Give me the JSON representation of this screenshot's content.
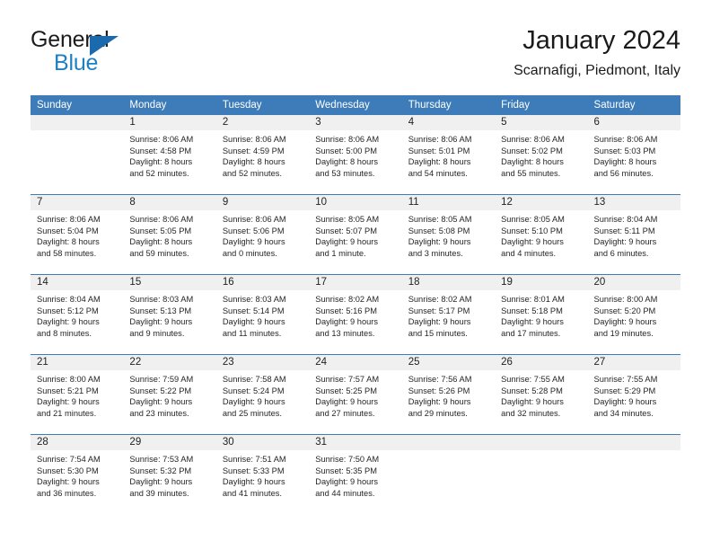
{
  "brand": {
    "name_top": "General",
    "name_bottom": "Blue",
    "accent_color": "#1f7fc4",
    "triangle_color": "#1a6aad"
  },
  "header": {
    "title": "January 2024",
    "subtitle": "Scarnafigi, Piedmont, Italy",
    "header_bg": "#3d7cb8",
    "daynum_bg": "#f0f0f0"
  },
  "weekday_headers": [
    "Sunday",
    "Monday",
    "Tuesday",
    "Wednesday",
    "Thursday",
    "Friday",
    "Saturday"
  ],
  "weeks": [
    [
      {
        "day": "",
        "sunrise": "",
        "sunset": "",
        "daylight1": "",
        "daylight2": ""
      },
      {
        "day": "1",
        "sunrise": "Sunrise: 8:06 AM",
        "sunset": "Sunset: 4:58 PM",
        "daylight1": "Daylight: 8 hours",
        "daylight2": "and 52 minutes."
      },
      {
        "day": "2",
        "sunrise": "Sunrise: 8:06 AM",
        "sunset": "Sunset: 4:59 PM",
        "daylight1": "Daylight: 8 hours",
        "daylight2": "and 52 minutes."
      },
      {
        "day": "3",
        "sunrise": "Sunrise: 8:06 AM",
        "sunset": "Sunset: 5:00 PM",
        "daylight1": "Daylight: 8 hours",
        "daylight2": "and 53 minutes."
      },
      {
        "day": "4",
        "sunrise": "Sunrise: 8:06 AM",
        "sunset": "Sunset: 5:01 PM",
        "daylight1": "Daylight: 8 hours",
        "daylight2": "and 54 minutes."
      },
      {
        "day": "5",
        "sunrise": "Sunrise: 8:06 AM",
        "sunset": "Sunset: 5:02 PM",
        "daylight1": "Daylight: 8 hours",
        "daylight2": "and 55 minutes."
      },
      {
        "day": "6",
        "sunrise": "Sunrise: 8:06 AM",
        "sunset": "Sunset: 5:03 PM",
        "daylight1": "Daylight: 8 hours",
        "daylight2": "and 56 minutes."
      }
    ],
    [
      {
        "day": "7",
        "sunrise": "Sunrise: 8:06 AM",
        "sunset": "Sunset: 5:04 PM",
        "daylight1": "Daylight: 8 hours",
        "daylight2": "and 58 minutes."
      },
      {
        "day": "8",
        "sunrise": "Sunrise: 8:06 AM",
        "sunset": "Sunset: 5:05 PM",
        "daylight1": "Daylight: 8 hours",
        "daylight2": "and 59 minutes."
      },
      {
        "day": "9",
        "sunrise": "Sunrise: 8:06 AM",
        "sunset": "Sunset: 5:06 PM",
        "daylight1": "Daylight: 9 hours",
        "daylight2": "and 0 minutes."
      },
      {
        "day": "10",
        "sunrise": "Sunrise: 8:05 AM",
        "sunset": "Sunset: 5:07 PM",
        "daylight1": "Daylight: 9 hours",
        "daylight2": "and 1 minute."
      },
      {
        "day": "11",
        "sunrise": "Sunrise: 8:05 AM",
        "sunset": "Sunset: 5:08 PM",
        "daylight1": "Daylight: 9 hours",
        "daylight2": "and 3 minutes."
      },
      {
        "day": "12",
        "sunrise": "Sunrise: 8:05 AM",
        "sunset": "Sunset: 5:10 PM",
        "daylight1": "Daylight: 9 hours",
        "daylight2": "and 4 minutes."
      },
      {
        "day": "13",
        "sunrise": "Sunrise: 8:04 AM",
        "sunset": "Sunset: 5:11 PM",
        "daylight1": "Daylight: 9 hours",
        "daylight2": "and 6 minutes."
      }
    ],
    [
      {
        "day": "14",
        "sunrise": "Sunrise: 8:04 AM",
        "sunset": "Sunset: 5:12 PM",
        "daylight1": "Daylight: 9 hours",
        "daylight2": "and 8 minutes."
      },
      {
        "day": "15",
        "sunrise": "Sunrise: 8:03 AM",
        "sunset": "Sunset: 5:13 PM",
        "daylight1": "Daylight: 9 hours",
        "daylight2": "and 9 minutes."
      },
      {
        "day": "16",
        "sunrise": "Sunrise: 8:03 AM",
        "sunset": "Sunset: 5:14 PM",
        "daylight1": "Daylight: 9 hours",
        "daylight2": "and 11 minutes."
      },
      {
        "day": "17",
        "sunrise": "Sunrise: 8:02 AM",
        "sunset": "Sunset: 5:16 PM",
        "daylight1": "Daylight: 9 hours",
        "daylight2": "and 13 minutes."
      },
      {
        "day": "18",
        "sunrise": "Sunrise: 8:02 AM",
        "sunset": "Sunset: 5:17 PM",
        "daylight1": "Daylight: 9 hours",
        "daylight2": "and 15 minutes."
      },
      {
        "day": "19",
        "sunrise": "Sunrise: 8:01 AM",
        "sunset": "Sunset: 5:18 PM",
        "daylight1": "Daylight: 9 hours",
        "daylight2": "and 17 minutes."
      },
      {
        "day": "20",
        "sunrise": "Sunrise: 8:00 AM",
        "sunset": "Sunset: 5:20 PM",
        "daylight1": "Daylight: 9 hours",
        "daylight2": "and 19 minutes."
      }
    ],
    [
      {
        "day": "21",
        "sunrise": "Sunrise: 8:00 AM",
        "sunset": "Sunset: 5:21 PM",
        "daylight1": "Daylight: 9 hours",
        "daylight2": "and 21 minutes."
      },
      {
        "day": "22",
        "sunrise": "Sunrise: 7:59 AM",
        "sunset": "Sunset: 5:22 PM",
        "daylight1": "Daylight: 9 hours",
        "daylight2": "and 23 minutes."
      },
      {
        "day": "23",
        "sunrise": "Sunrise: 7:58 AM",
        "sunset": "Sunset: 5:24 PM",
        "daylight1": "Daylight: 9 hours",
        "daylight2": "and 25 minutes."
      },
      {
        "day": "24",
        "sunrise": "Sunrise: 7:57 AM",
        "sunset": "Sunset: 5:25 PM",
        "daylight1": "Daylight: 9 hours",
        "daylight2": "and 27 minutes."
      },
      {
        "day": "25",
        "sunrise": "Sunrise: 7:56 AM",
        "sunset": "Sunset: 5:26 PM",
        "daylight1": "Daylight: 9 hours",
        "daylight2": "and 29 minutes."
      },
      {
        "day": "26",
        "sunrise": "Sunrise: 7:55 AM",
        "sunset": "Sunset: 5:28 PM",
        "daylight1": "Daylight: 9 hours",
        "daylight2": "and 32 minutes."
      },
      {
        "day": "27",
        "sunrise": "Sunrise: 7:55 AM",
        "sunset": "Sunset: 5:29 PM",
        "daylight1": "Daylight: 9 hours",
        "daylight2": "and 34 minutes."
      }
    ],
    [
      {
        "day": "28",
        "sunrise": "Sunrise: 7:54 AM",
        "sunset": "Sunset: 5:30 PM",
        "daylight1": "Daylight: 9 hours",
        "daylight2": "and 36 minutes."
      },
      {
        "day": "29",
        "sunrise": "Sunrise: 7:53 AM",
        "sunset": "Sunset: 5:32 PM",
        "daylight1": "Daylight: 9 hours",
        "daylight2": "and 39 minutes."
      },
      {
        "day": "30",
        "sunrise": "Sunrise: 7:51 AM",
        "sunset": "Sunset: 5:33 PM",
        "daylight1": "Daylight: 9 hours",
        "daylight2": "and 41 minutes."
      },
      {
        "day": "31",
        "sunrise": "Sunrise: 7:50 AM",
        "sunset": "Sunset: 5:35 PM",
        "daylight1": "Daylight: 9 hours",
        "daylight2": "and 44 minutes."
      },
      {
        "day": "",
        "sunrise": "",
        "sunset": "",
        "daylight1": "",
        "daylight2": ""
      },
      {
        "day": "",
        "sunrise": "",
        "sunset": "",
        "daylight1": "",
        "daylight2": ""
      },
      {
        "day": "",
        "sunrise": "",
        "sunset": "",
        "daylight1": "",
        "daylight2": ""
      }
    ]
  ]
}
